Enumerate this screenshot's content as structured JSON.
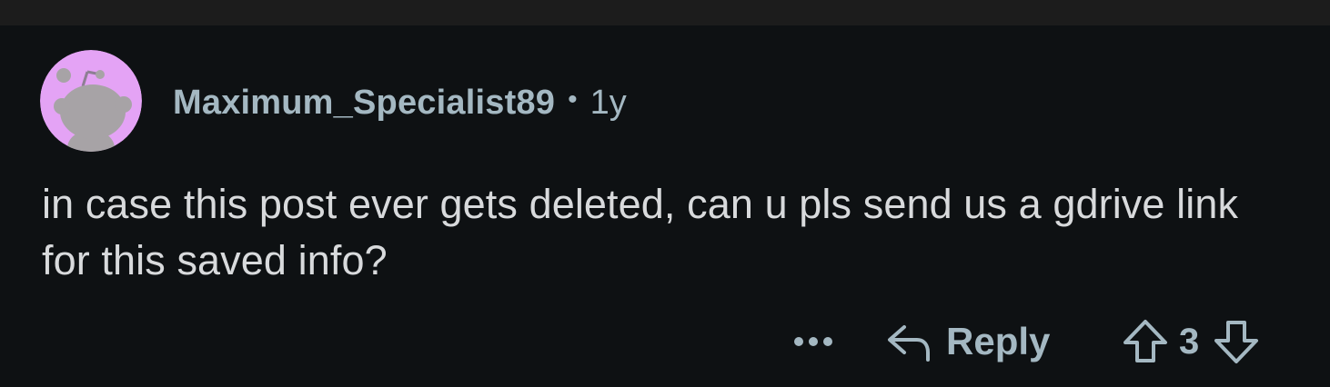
{
  "comment": {
    "username": "Maximum_Specialist89",
    "separator": "•",
    "age": "1y",
    "body": "in case this post ever gets deleted, can u pls send us a gdrive link for this saved info?",
    "avatar_icon": "snoo-avatar-icon",
    "avatar_bg": "#e4a3f5"
  },
  "actions": {
    "more_icon": "more-options-icon",
    "reply_label": "Reply",
    "reply_icon": "reply-arrow-icon",
    "upvote_icon": "upvote-arrow-icon",
    "vote_count": "3",
    "downvote_icon": "downvote-arrow-icon"
  },
  "colors": {
    "background": "#0e1113",
    "meta_text": "#a4b8c2",
    "body_text": "#d8dadc"
  }
}
